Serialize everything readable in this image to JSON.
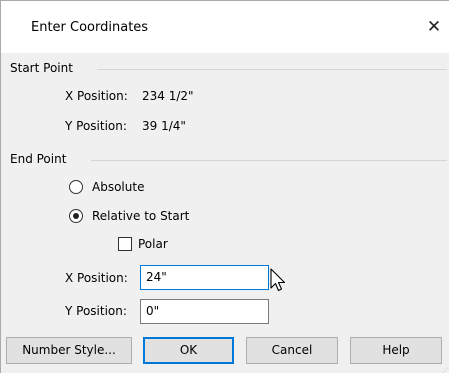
{
  "dialog": {
    "title": "Enter Coordinates",
    "close_glyph": "✕"
  },
  "start_point": {
    "group_label": "Start Point",
    "x_label": "X Position:",
    "x_value": "234 1/2\"",
    "y_label": "Y Position:",
    "y_value": "39 1/4\""
  },
  "end_point": {
    "group_label": "End Point",
    "absolute_label": "Absolute",
    "absolute_selected": false,
    "relative_label": "Relative to Start",
    "relative_selected": true,
    "polar_label": "Polar",
    "polar_checked": false,
    "x_label": "X Position:",
    "x_value": "24\"",
    "y_label": "Y Position:",
    "y_value": "0\""
  },
  "buttons": {
    "number_style": "Number Style...",
    "ok": "OK",
    "cancel": "Cancel",
    "help": "Help"
  },
  "icons": {
    "close": "close-icon",
    "cursor": "mouse-pointer-icon",
    "grip": "resize-grip-icon"
  },
  "colors": {
    "focus_accent": "#0078d7",
    "dialog_background": "#f0f0f0"
  }
}
